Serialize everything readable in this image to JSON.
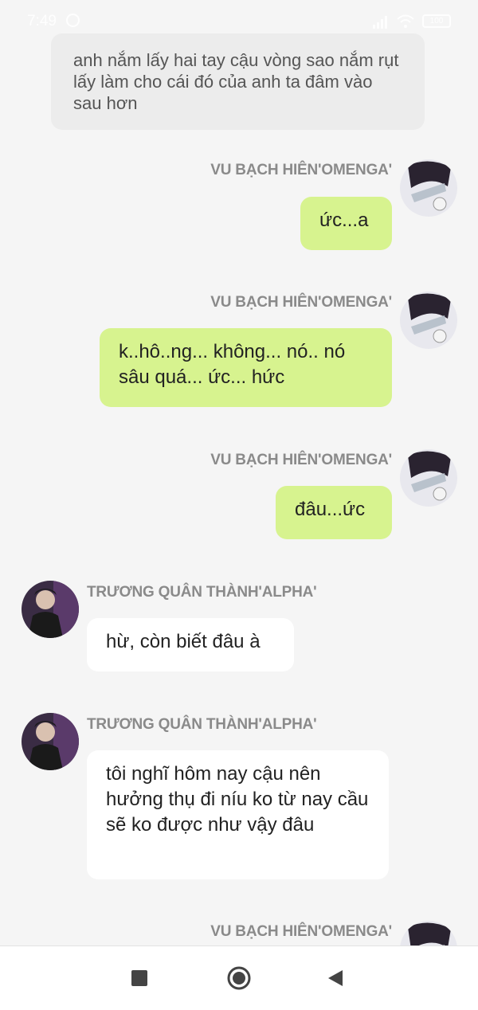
{
  "status_bar": {
    "time": "7:49",
    "battery": "100"
  },
  "messages": [
    {
      "kind": "narration",
      "text": "anh nắm lấy hai tay cậu vòng sao nắm rụt lấy làm cho cái đó của anh ta đâm vào sau hơn"
    },
    {
      "kind": "me",
      "sender": "VU BẠCH HIÊN'OMENGA'",
      "text": "ức...a"
    },
    {
      "kind": "me",
      "sender": "VU BẠCH HIÊN'OMENGA'",
      "text": "k..hô..ng... không... nó.. nó sâu quá... ức... hức"
    },
    {
      "kind": "me",
      "sender": "VU BẠCH HIÊN'OMENGA'",
      "text": "đâu...ức"
    },
    {
      "kind": "other",
      "sender": "TRƯƠNG QUÂN THÀNH'ALPHA'",
      "text": "hừ, còn biết đâu à"
    },
    {
      "kind": "other",
      "sender": "TRƯƠNG QUÂN THÀNH'ALPHA'",
      "text": "tôi nghĩ hôm nay cậu nên hưởng thụ đi níu ko từ nay cầu sẽ ko được như vậy đâu"
    },
    {
      "kind": "me",
      "sender": "VU BẠCH HIÊN'OMENGA'",
      "text": ""
    }
  ],
  "nav": {
    "icons": [
      "square-icon",
      "home-circle-icon",
      "back-triangle-icon"
    ]
  }
}
